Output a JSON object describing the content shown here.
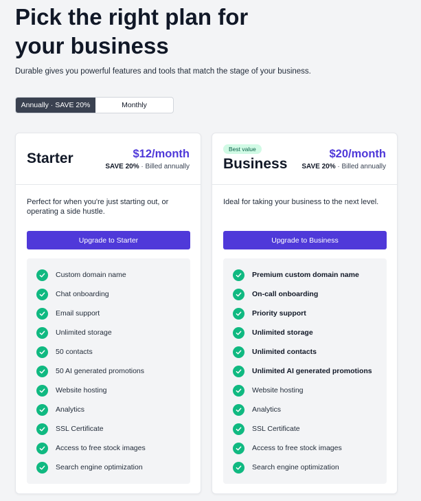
{
  "header": {
    "title_line1": "Pick the right plan for",
    "title_line2": "your business",
    "subtitle": "Durable gives you powerful features and tools that match the stage of your business."
  },
  "billing_toggle": {
    "options": [
      "Annually · SAVE 20%",
      "Monthly"
    ],
    "selected": "Annually · SAVE 20%"
  },
  "colors": {
    "accent": "#4f39d9",
    "check": "#10b981",
    "toggle_active": "#3a4150",
    "badge_bg": "#d1fae5"
  },
  "plans": [
    {
      "name": "Starter",
      "badge": "",
      "price": "$12/month",
      "save": "SAVE 20%",
      "billing": "· Billed annually",
      "description": "Perfect for when you're just starting out, or operating a side hustle.",
      "cta": "Upgrade to Starter",
      "features": [
        {
          "label": "Custom domain name",
          "bold": false
        },
        {
          "label": "Chat onboarding",
          "bold": false
        },
        {
          "label": "Email support",
          "bold": false
        },
        {
          "label": "Unlimited storage",
          "bold": false
        },
        {
          "label": "50 contacts",
          "bold": false
        },
        {
          "label": "50 AI generated promotions",
          "bold": false
        },
        {
          "label": "Website hosting",
          "bold": false
        },
        {
          "label": "Analytics",
          "bold": false
        },
        {
          "label": "SSL Certificate",
          "bold": false
        },
        {
          "label": "Access to free stock images",
          "bold": false
        },
        {
          "label": "Search engine optimization",
          "bold": false
        }
      ]
    },
    {
      "name": "Business",
      "badge": "Best value",
      "price": "$20/month",
      "save": "SAVE 20%",
      "billing": "· Billed annually",
      "description": "Ideal for taking your business to the next level.",
      "cta": "Upgrade to Business",
      "features": [
        {
          "label": "Premium custom domain name",
          "bold": true
        },
        {
          "label": "On-call onboarding",
          "bold": true
        },
        {
          "label": "Priority support",
          "bold": true
        },
        {
          "label": "Unlimited storage",
          "bold": true
        },
        {
          "label": "Unlimited contacts",
          "bold": true
        },
        {
          "label": "Unlimited AI generated promotions",
          "bold": true
        },
        {
          "label": "Website hosting",
          "bold": false
        },
        {
          "label": "Analytics",
          "bold": false
        },
        {
          "label": "SSL Certificate",
          "bold": false
        },
        {
          "label": "Access to free stock images",
          "bold": false
        },
        {
          "label": "Search engine optimization",
          "bold": false
        }
      ]
    }
  ]
}
